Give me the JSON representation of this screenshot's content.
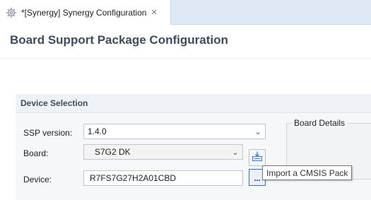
{
  "editor_tab": {
    "title": "*[Synergy] Synergy Configuration",
    "close_glyph": "✕",
    "icon": "gear-icon"
  },
  "page": {
    "title": "Board Support Package Configuration"
  },
  "device_selection": {
    "title": "Device Selection",
    "ssp_version": {
      "label": "SSP version:",
      "value": "1.4.0"
    },
    "board": {
      "label": "Board:",
      "value": "S7G2 DK"
    },
    "device": {
      "label": "Device:",
      "value": "R7FS7G27H2A01CBD"
    },
    "browse_label": "...",
    "import_icon": "import-pack-icon"
  },
  "board_details": {
    "title": "Board Details"
  },
  "tooltip": {
    "text": "Import a CMSIS Pack"
  },
  "colors": {
    "tab_strip": "#dfe9f6",
    "header_text": "#3d4b5c",
    "section_bg": "#f6f7f9",
    "focus_border": "#2d6fc0"
  }
}
